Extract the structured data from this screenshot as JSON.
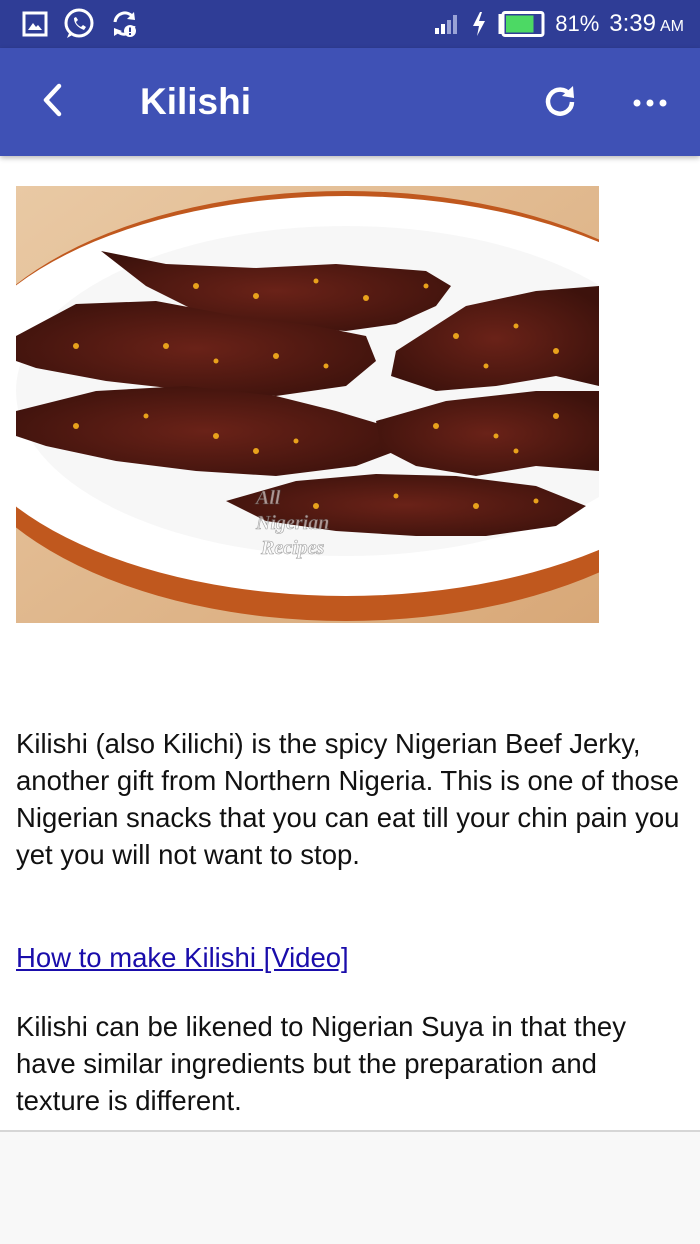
{
  "status_bar": {
    "battery_percent": "81%",
    "time": "3:39",
    "ampm": "AM",
    "icons": [
      "gallery-icon",
      "whatsapp-icon",
      "sync-alert-icon",
      "signal-icon",
      "charging-icon",
      "battery-icon"
    ],
    "battery_level": 0.81
  },
  "app_bar": {
    "title": "Kilishi",
    "icons": [
      "back-arrow-icon",
      "refresh-icon",
      "more-vert-icon"
    ]
  },
  "article": {
    "paragraph1": "Kilishi (also Kilichi) is the spicy Nigerian Beef Jerky, another gift from Northern Nigeria. This is one of those Nigerian snacks that you can eat till your chin pain you yet you will not want to stop.",
    "video_link": "How to make Kilishi [Video]",
    "paragraph2": "Kilishi can be likened to Nigerian Suya in that they have similar ingredients but the preparation and texture is different.",
    "photo_watermark": [
      "All",
      "Nigerian",
      "Recipes"
    ]
  },
  "colors": {
    "status_bar": "#2f3d96",
    "app_bar": "#3f51b5",
    "link": "#1a0dab",
    "battery_fill": "#4cd964"
  }
}
